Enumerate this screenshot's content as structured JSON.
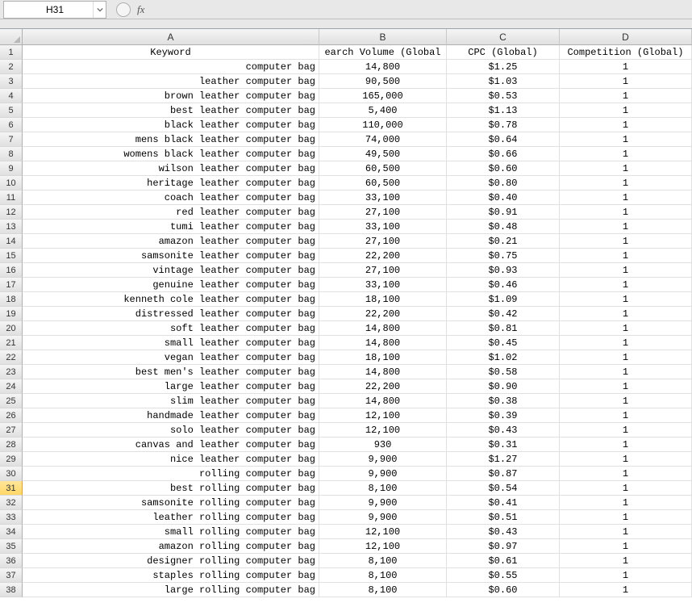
{
  "nameBox": "H31",
  "fxLabel": "fx",
  "formulaValue": "",
  "columns": [
    "A",
    "B",
    "C",
    "D"
  ],
  "headerRow": {
    "A": "Keyword",
    "B": "earch Volume (Global",
    "C": "CPC (Global)",
    "D": "Competition (Global)"
  },
  "activeRow": 31,
  "rows": [
    {
      "n": 2,
      "A": "computer bag",
      "B": "14,800",
      "C": "$1.25",
      "D": "1"
    },
    {
      "n": 3,
      "A": "leather computer bag",
      "B": "90,500",
      "C": "$1.03",
      "D": "1"
    },
    {
      "n": 4,
      "A": "brown leather computer bag",
      "B": "165,000",
      "C": "$0.53",
      "D": "1"
    },
    {
      "n": 5,
      "A": "best leather computer bag",
      "B": "5,400",
      "C": "$1.13",
      "D": "1"
    },
    {
      "n": 6,
      "A": "black leather computer bag",
      "B": "110,000",
      "C": "$0.78",
      "D": "1"
    },
    {
      "n": 7,
      "A": "mens black leather computer bag",
      "B": "74,000",
      "C": "$0.64",
      "D": "1"
    },
    {
      "n": 8,
      "A": "womens black leather computer bag",
      "B": "49,500",
      "C": "$0.66",
      "D": "1"
    },
    {
      "n": 9,
      "A": "wilson leather computer bag",
      "B": "60,500",
      "C": "$0.60",
      "D": "1"
    },
    {
      "n": 10,
      "A": "heritage leather computer bag",
      "B": "60,500",
      "C": "$0.80",
      "D": "1"
    },
    {
      "n": 11,
      "A": "coach leather computer bag",
      "B": "33,100",
      "C": "$0.40",
      "D": "1"
    },
    {
      "n": 12,
      "A": "red leather computer bag",
      "B": "27,100",
      "C": "$0.91",
      "D": "1"
    },
    {
      "n": 13,
      "A": "tumi leather computer bag",
      "B": "33,100",
      "C": "$0.48",
      "D": "1"
    },
    {
      "n": 14,
      "A": "amazon leather computer bag",
      "B": "27,100",
      "C": "$0.21",
      "D": "1"
    },
    {
      "n": 15,
      "A": "samsonite leather computer bag",
      "B": "22,200",
      "C": "$0.75",
      "D": "1"
    },
    {
      "n": 16,
      "A": "vintage leather computer bag",
      "B": "27,100",
      "C": "$0.93",
      "D": "1"
    },
    {
      "n": 17,
      "A": "genuine leather computer bag",
      "B": "33,100",
      "C": "$0.46",
      "D": "1"
    },
    {
      "n": 18,
      "A": "kenneth cole leather computer bag",
      "B": "18,100",
      "C": "$1.09",
      "D": "1"
    },
    {
      "n": 19,
      "A": "distressed leather computer bag",
      "B": "22,200",
      "C": "$0.42",
      "D": "1"
    },
    {
      "n": 20,
      "A": "soft leather computer bag",
      "B": "14,800",
      "C": "$0.81",
      "D": "1"
    },
    {
      "n": 21,
      "A": "small leather computer bag",
      "B": "14,800",
      "C": "$0.45",
      "D": "1"
    },
    {
      "n": 22,
      "A": "vegan leather computer bag",
      "B": "18,100",
      "C": "$1.02",
      "D": "1"
    },
    {
      "n": 23,
      "A": "best men's leather computer bag",
      "B": "14,800",
      "C": "$0.58",
      "D": "1"
    },
    {
      "n": 24,
      "A": "large leather computer bag",
      "B": "22,200",
      "C": "$0.90",
      "D": "1"
    },
    {
      "n": 25,
      "A": "slim leather computer bag",
      "B": "14,800",
      "C": "$0.38",
      "D": "1"
    },
    {
      "n": 26,
      "A": "handmade leather computer bag",
      "B": "12,100",
      "C": "$0.39",
      "D": "1"
    },
    {
      "n": 27,
      "A": "solo leather computer bag",
      "B": "12,100",
      "C": "$0.43",
      "D": "1"
    },
    {
      "n": 28,
      "A": "canvas and leather computer bag",
      "B": "930",
      "C": "$0.31",
      "D": "1"
    },
    {
      "n": 29,
      "A": "nice leather computer bag",
      "B": "9,900",
      "C": "$1.27",
      "D": "1"
    },
    {
      "n": 30,
      "A": "rolling computer bag",
      "B": "9,900",
      "C": "$0.87",
      "D": "1"
    },
    {
      "n": 31,
      "A": "best rolling computer bag",
      "B": "8,100",
      "C": "$0.54",
      "D": "1"
    },
    {
      "n": 32,
      "A": "samsonite rolling computer bag",
      "B": "9,900",
      "C": "$0.41",
      "D": "1"
    },
    {
      "n": 33,
      "A": "leather rolling computer bag",
      "B": "9,900",
      "C": "$0.51",
      "D": "1"
    },
    {
      "n": 34,
      "A": "small rolling computer bag",
      "B": "12,100",
      "C": "$0.43",
      "D": "1"
    },
    {
      "n": 35,
      "A": "amazon rolling computer bag",
      "B": "12,100",
      "C": "$0.97",
      "D": "1"
    },
    {
      "n": 36,
      "A": "designer rolling computer bag",
      "B": "8,100",
      "C": "$0.61",
      "D": "1"
    },
    {
      "n": 37,
      "A": "staples rolling computer bag",
      "B": "8,100",
      "C": "$0.55",
      "D": "1"
    },
    {
      "n": 38,
      "A": "large rolling computer bag",
      "B": "8,100",
      "C": "$0.60",
      "D": "1"
    }
  ]
}
